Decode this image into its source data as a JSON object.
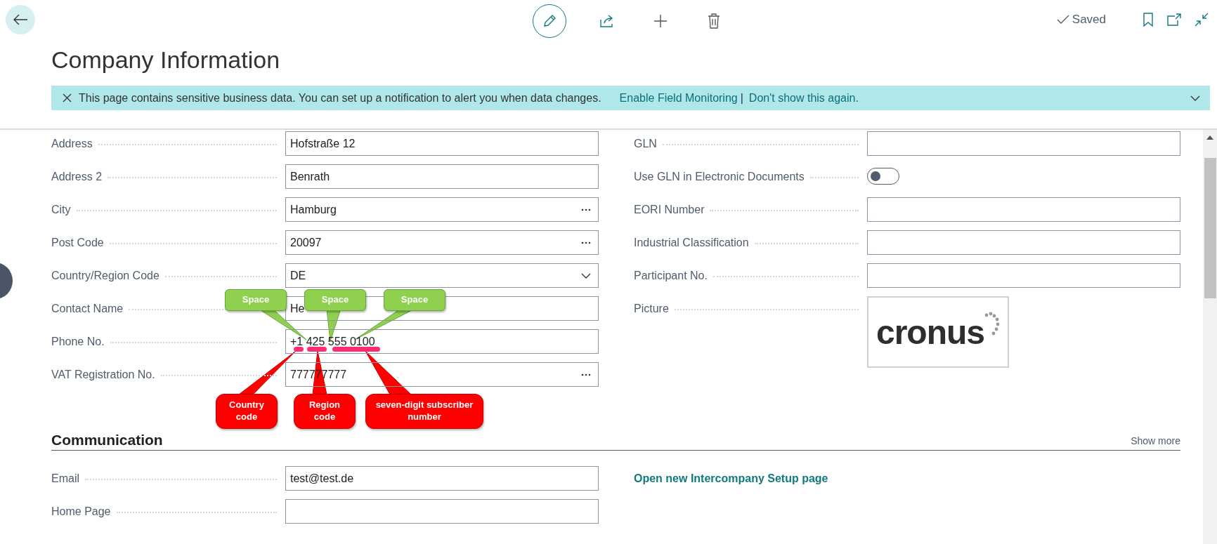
{
  "toolbar": {
    "saved_label": "Saved"
  },
  "title": "Company Information",
  "banner": {
    "message": "This page contains sensitive business data. You can set up a notification to alert you when data changes.",
    "links": [
      "Enable Field Monitoring",
      "Don't show this again."
    ],
    "separator": "|"
  },
  "general": {
    "left": [
      {
        "label": "Address",
        "kind": "text",
        "value": "Hofstraße 12"
      },
      {
        "label": "Address 2",
        "kind": "text",
        "value": "Benrath"
      },
      {
        "label": "City",
        "kind": "lookup",
        "value": "Hamburg"
      },
      {
        "label": "Post Code",
        "kind": "lookup",
        "value": "20097"
      },
      {
        "label": "Country/Region Code",
        "kind": "dropdown",
        "value": "DE"
      },
      {
        "label": "Contact Name",
        "kind": "text",
        "value": "He"
      },
      {
        "label": "Phone No.",
        "kind": "text",
        "value": "+1 425 555 0100"
      },
      {
        "label": "VAT Registration No.",
        "kind": "lookup",
        "value": "777777777"
      }
    ],
    "right": [
      {
        "label": "GLN",
        "kind": "text"
      },
      {
        "label": "Use GLN in Electronic Documents",
        "kind": "toggle",
        "on": false
      },
      {
        "label": "EORI Number",
        "kind": "text"
      },
      {
        "label": "Industrial Classification",
        "kind": "text"
      },
      {
        "label": "Participant No.",
        "kind": "text"
      },
      {
        "label": "Picture",
        "kind": "picture",
        "logo_text": "cronus"
      }
    ]
  },
  "communication": {
    "title": "Communication",
    "show_more": "Show more",
    "left": [
      {
        "label": "Email",
        "kind": "text",
        "value": "test@test.de"
      },
      {
        "label": "Home Page",
        "kind": "text"
      }
    ],
    "link": "Open new Intercompany Setup page"
  },
  "annotations": [
    {
      "kind": "space",
      "text": "Space"
    },
    {
      "kind": "space",
      "text": "Space"
    },
    {
      "kind": "space",
      "text": "Space"
    },
    {
      "kind": "label",
      "text": "Country code"
    },
    {
      "kind": "label",
      "text": "Region code"
    },
    {
      "kind": "label",
      "text": "seven-digit subscriber number"
    }
  ]
}
